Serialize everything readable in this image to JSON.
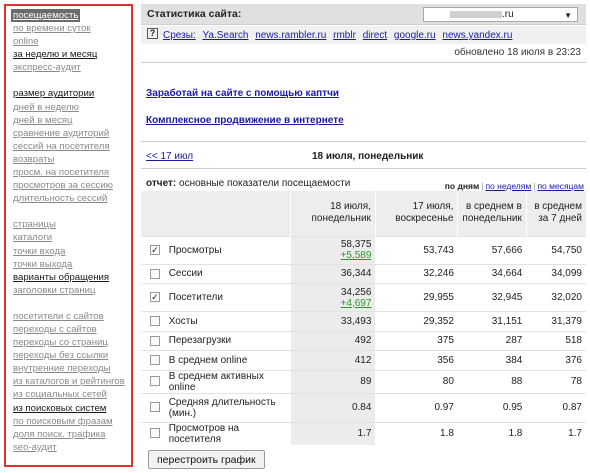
{
  "sidebar": {
    "groups": [
      [
        {
          "label": "посещаемость",
          "style": "active"
        },
        {
          "label": "по времени суток",
          "style": "gray"
        },
        {
          "label": "online",
          "style": "gray"
        },
        {
          "label": "за неделю и месяц",
          "style": "dark"
        },
        {
          "label": "экспресс-аудит",
          "style": "gray"
        }
      ],
      [
        {
          "label": "размер аудитории",
          "style": "dark"
        },
        {
          "label": "дней в неделю",
          "style": "gray"
        },
        {
          "label": "дней в месяц",
          "style": "gray"
        },
        {
          "label": "сравнение аудиторий",
          "style": "gray"
        },
        {
          "label": "сессий на посетителя",
          "style": "gray"
        },
        {
          "label": "возвраты",
          "style": "gray"
        },
        {
          "label": "просм. на посетителя",
          "style": "gray"
        },
        {
          "label": "просмотров за сессию",
          "style": "gray"
        },
        {
          "label": "длительность сессий",
          "style": "gray"
        }
      ],
      [
        {
          "label": "страницы",
          "style": "gray"
        },
        {
          "label": "каталоги",
          "style": "gray"
        },
        {
          "label": "точки входа",
          "style": "gray"
        },
        {
          "label": "точки выхода",
          "style": "gray"
        },
        {
          "label": "варианты обращения",
          "style": "dark"
        },
        {
          "label": "заголовки страниц",
          "style": "gray"
        }
      ],
      [
        {
          "label": "посетители с сайтов",
          "style": "gray"
        },
        {
          "label": "переходы с сайтов",
          "style": "gray"
        },
        {
          "label": "переходы со страниц",
          "style": "gray"
        },
        {
          "label": "переходы без ссылки",
          "style": "gray"
        },
        {
          "label": "внутренние переходы",
          "style": "gray"
        },
        {
          "label": "из каталогов и рейтингов",
          "style": "gray"
        },
        {
          "label": "из социальных сетей",
          "style": "gray"
        },
        {
          "label": "из поисковых систем",
          "style": "dark"
        },
        {
          "label": "по поисковым фразам",
          "style": "gray"
        },
        {
          "label": "доля поиск. трафика",
          "style": "gray"
        },
        {
          "label": "seo-аудит",
          "style": "gray"
        }
      ]
    ]
  },
  "header": {
    "title": "Статистика сайта:",
    "site_value_suffix": ".ru",
    "slices_label": "Срезы:",
    "slices": [
      "Ya.Search",
      "news.rambler.ru",
      "rmblr",
      "direct",
      "google.ru",
      "news.yandex.ru"
    ],
    "updated": "обновлено 18 июля в 23:23"
  },
  "promo": {
    "link1": "Заработай на сайте с помощью каптчи",
    "link2": "Комплексное продвижение в интернете"
  },
  "nav": {
    "prev": "<< 17 июл",
    "current": "18 июля, понедельник"
  },
  "report": {
    "label": "отчет:",
    "title": "основные показатели посещаемости",
    "period_current": "по дням",
    "period_week": "по неделям",
    "period_month": "по месяцам"
  },
  "table": {
    "headers": [
      "18 июля, понедельник",
      "17 июля, воскресенье",
      "в среднем в понедельник",
      "в среднем за 7 дней"
    ],
    "rows": [
      {
        "checked": true,
        "name": "Просмотры",
        "values": [
          "58,375",
          "53,743",
          "57,666",
          "54,750"
        ],
        "delta": "+5,589"
      },
      {
        "checked": false,
        "name": "Сессии",
        "values": [
          "36,344",
          "32,246",
          "34,664",
          "34,099"
        ]
      },
      {
        "checked": true,
        "name": "Посетители",
        "values": [
          "34,256",
          "29,955",
          "32,945",
          "32,020"
        ],
        "delta": "+4,697"
      },
      {
        "checked": false,
        "name": "Хосты",
        "values": [
          "33,493",
          "29,352",
          "31,151",
          "31,379"
        ]
      },
      {
        "checked": false,
        "name": "Перезагрузки",
        "values": [
          "492",
          "375",
          "287",
          "518"
        ]
      },
      {
        "checked": false,
        "name": "В среднем online",
        "values": [
          "412",
          "356",
          "384",
          "376"
        ]
      },
      {
        "checked": false,
        "name": "В среднем активных online",
        "values": [
          "89",
          "80",
          "88",
          "78"
        ]
      },
      {
        "checked": false,
        "name": "Средняя длительность (мин.)",
        "values": [
          "0.84",
          "0.97",
          "0.95",
          "0.87"
        ]
      },
      {
        "checked": false,
        "name": "Просмотров на посетителя",
        "values": [
          "1.7",
          "1.8",
          "1.8",
          "1.7"
        ]
      }
    ]
  },
  "actions": {
    "rebuild": "перестроить график"
  }
}
